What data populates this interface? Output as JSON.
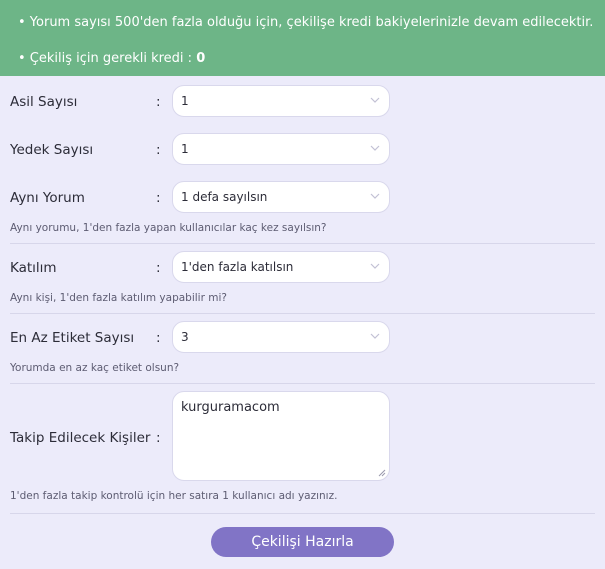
{
  "alert": {
    "line1": "• Yorum sayısı 500'den fazla olduğu için, çekilişe kredi bakiyelerinizle devam edilecektir.",
    "line2_prefix": "• Çekiliş için gerekli kredi : ",
    "line2_value": "0"
  },
  "colon": ":",
  "fields": {
    "asil": {
      "label": "Asil Sayısı",
      "value": "1"
    },
    "yedek": {
      "label": "Yedek Sayısı",
      "value": "1"
    },
    "ayni_yorum": {
      "label": "Aynı Yorum",
      "value": "1 defa sayılsın",
      "hint": "Aynı yorumu, 1'den fazla yapan kullanıcılar kaç kez sayılsın?"
    },
    "katilim": {
      "label": "Katılım",
      "value": "1'den fazla katılsın",
      "hint": "Aynı kişi, 1'den fazla katılım yapabilir mi?"
    },
    "etiket": {
      "label": "En Az Etiket Sayısı",
      "value": "3",
      "hint": "Yorumda en az kaç etiket olsun?"
    },
    "takip": {
      "label": "Takip Edilecek Kişiler",
      "value": "kurguramacom",
      "hint": "1'den fazla takip kontrolü için her satıra 1 kullanıcı adı yazınız."
    }
  },
  "submit_label": "Çekilişi Hazırla",
  "icons": {
    "select": "chevron-down-icon",
    "textarea": "resize-grip-icon"
  },
  "colors": {
    "alert_bg": "#6db587",
    "page_bg": "#ecebfa",
    "button_bg": "#8174c6"
  }
}
